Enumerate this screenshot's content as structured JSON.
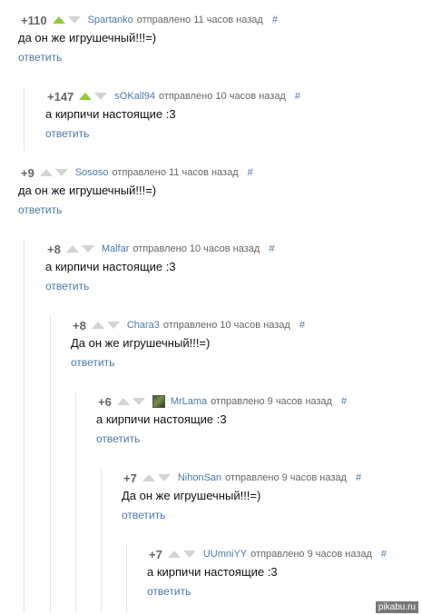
{
  "comments": [
    {
      "score": "+110",
      "up_active": true,
      "user": "Spartanko",
      "posted": "отправлено 11 часов назад",
      "hash": "#",
      "text": "да он же игрушечный!!!=)",
      "reply": "ответить"
    },
    {
      "score": "+147",
      "up_active": true,
      "user": "sOKall94",
      "posted": "отправлено 10 часов назад",
      "hash": "#",
      "text": "а кирпичи настоящие :3",
      "reply": "ответить"
    },
    {
      "score": "+9",
      "up_active": false,
      "user": "Sososo",
      "posted": "отправлено 11 часов назад",
      "hash": "#",
      "text": "да он же игрушечный!!!=)",
      "reply": "ответить"
    },
    {
      "score": "+8",
      "up_active": false,
      "user": "Malfar",
      "posted": "отправлено 10 часов назад",
      "hash": "#",
      "text": "а кирпичи настоящие :3",
      "reply": "ответить"
    },
    {
      "score": "+8",
      "up_active": false,
      "user": "Chara3",
      "posted": "отправлено 10 часов назад",
      "hash": "#",
      "text": "Да он же игрушечный!!!=)",
      "reply": "ответить"
    },
    {
      "score": "+6",
      "up_active": false,
      "user": "MrLama",
      "posted": "отправлено 9 часов назад",
      "hash": "#",
      "text": "а кирпичи настоящие :3",
      "reply": "ответить",
      "avatar": true
    },
    {
      "score": "+7",
      "up_active": false,
      "user": "NihonSan",
      "posted": "отправлено 9 часов назад",
      "hash": "#",
      "text": "Да он же игрушечный!!!=)",
      "reply": "ответить"
    },
    {
      "score": "+7",
      "up_active": false,
      "user": "UUmniYY",
      "posted": "отправлено 9 часов назад",
      "hash": "#",
      "text": "а кирпичи настоящие :3",
      "reply": "ответить"
    }
  ],
  "watermark": "pikabu.ru",
  "colors": {
    "link": "#4a79a8",
    "vote_up_active": "#94c93a",
    "vote_inactive": "#d3d3d3"
  }
}
